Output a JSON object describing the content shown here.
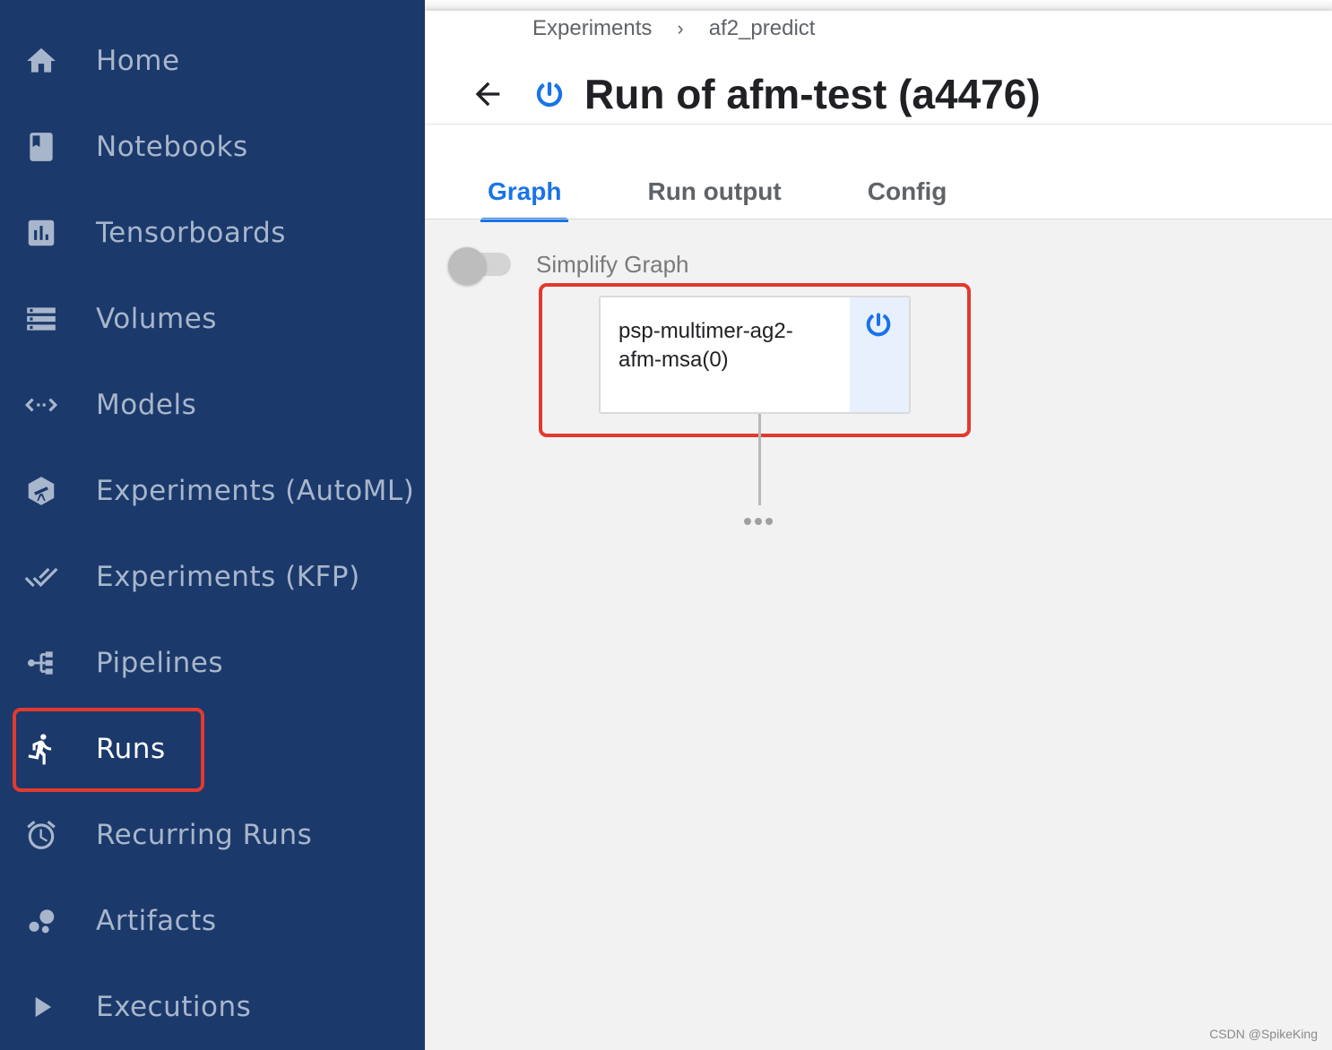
{
  "sidebar": {
    "items": [
      {
        "label": "Home",
        "icon": "home-icon"
      },
      {
        "label": "Notebooks",
        "icon": "notebook-icon"
      },
      {
        "label": "Tensorboards",
        "icon": "bar-chart-icon"
      },
      {
        "label": "Volumes",
        "icon": "storage-icon"
      },
      {
        "label": "Models",
        "icon": "code-arrows-icon"
      },
      {
        "label": "Experiments (AutoML)",
        "icon": "telescope-icon"
      },
      {
        "label": "Experiments (KFP)",
        "icon": "done-all-icon"
      },
      {
        "label": "Pipelines",
        "icon": "pipeline-icon"
      },
      {
        "label": "Runs",
        "icon": "running-person-icon",
        "active": true
      },
      {
        "label": "Recurring Runs",
        "icon": "alarm-clock-icon"
      },
      {
        "label": "Artifacts",
        "icon": "bubbles-icon"
      },
      {
        "label": "Executions",
        "icon": "play-arrow-icon"
      }
    ]
  },
  "header": {
    "breadcrumb": [
      "Experiments",
      "af2_predict"
    ],
    "breadcrumb_separator": "›",
    "title": "Run of afm-test (a4476)",
    "status_icon": "running-status-icon"
  },
  "tabs": [
    {
      "label": "Graph",
      "active": true
    },
    {
      "label": "Run output"
    },
    {
      "label": "Config"
    }
  ],
  "graph": {
    "toggle_label": "Simplify Graph",
    "toggle_on": false,
    "node": {
      "label": "psp-multimer-ag2-afm-msa(0)",
      "status": "running"
    }
  },
  "watermark": "CSDN @SpikeKing",
  "colors": {
    "sidebar_bg": "#1b396b",
    "accent": "#1a73e8",
    "highlight": "#e23a2e"
  }
}
